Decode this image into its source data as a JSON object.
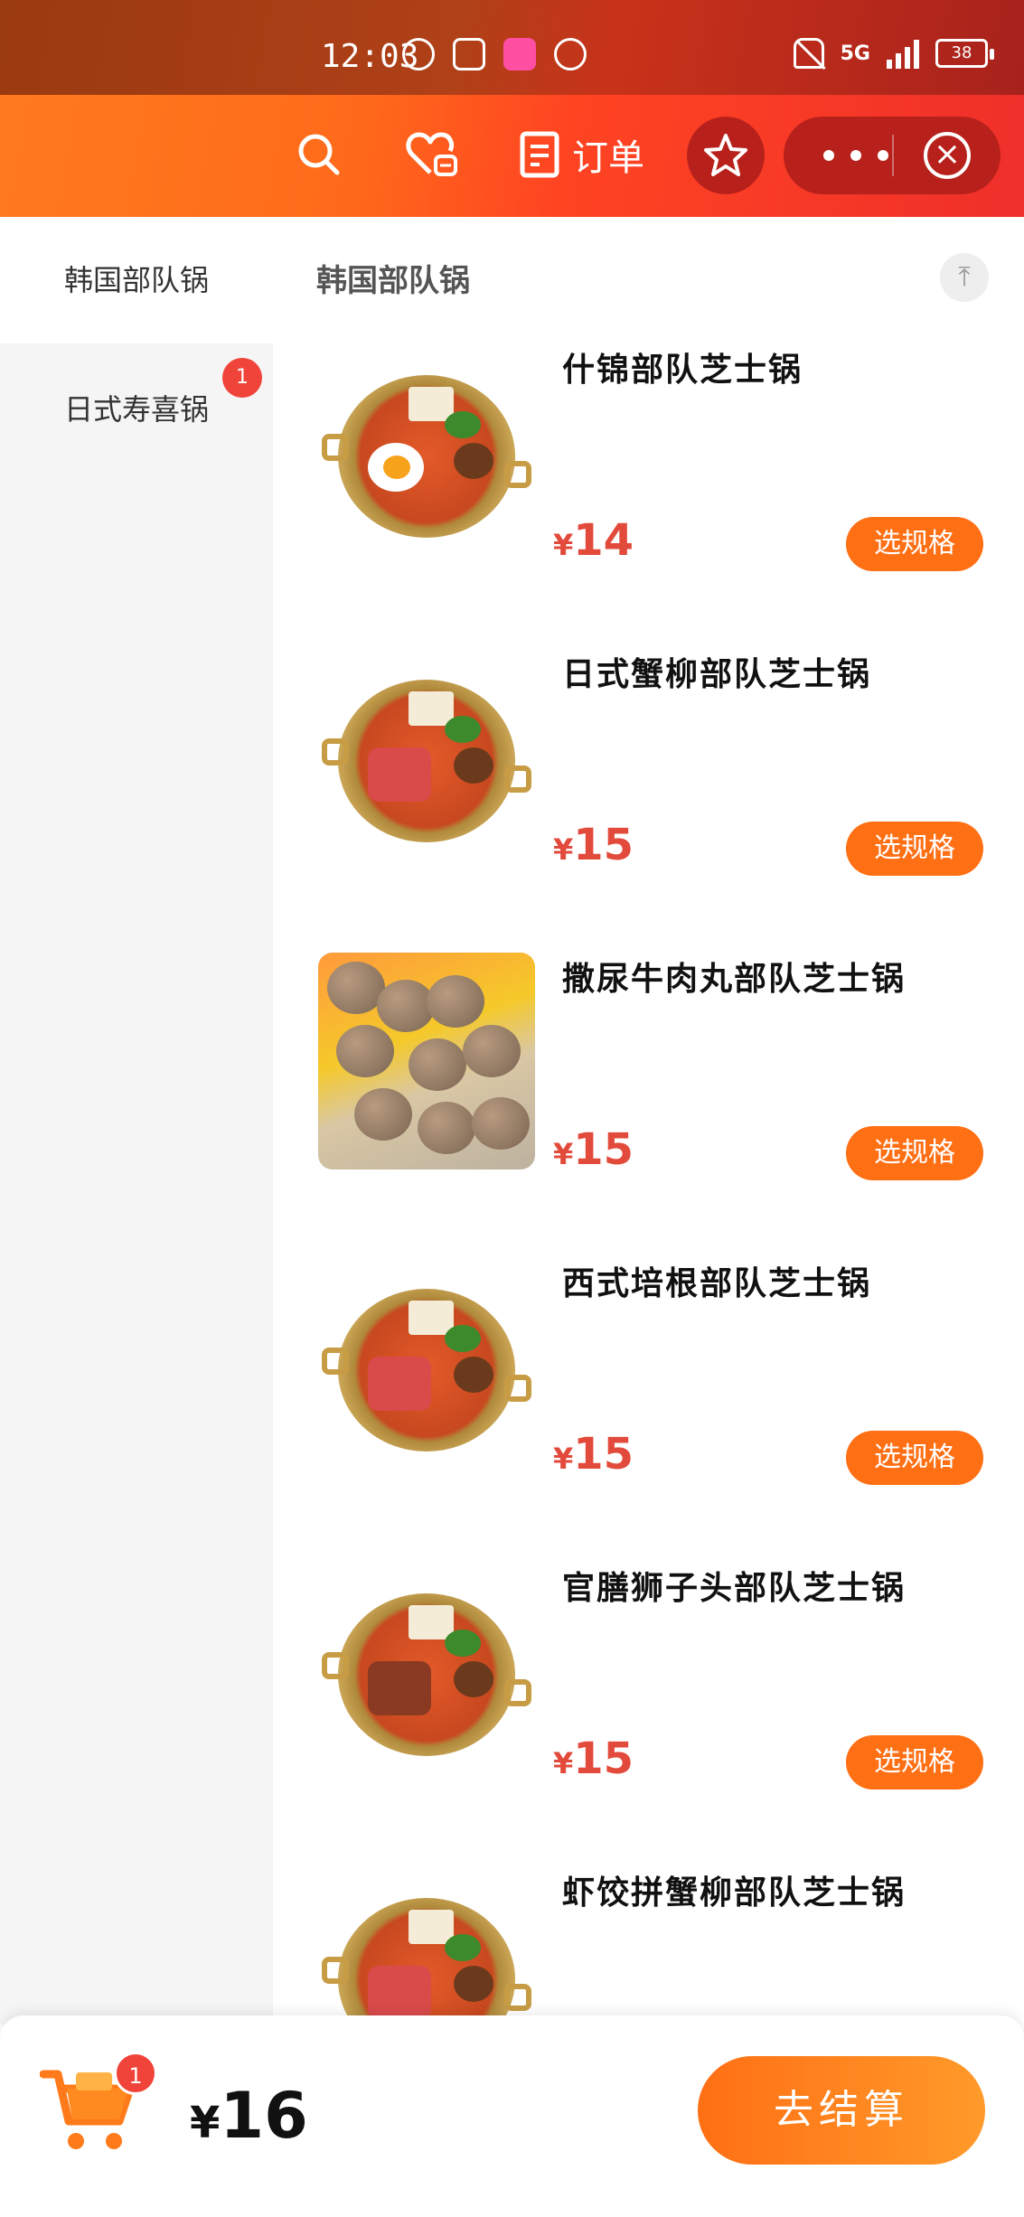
{
  "status_bar": {
    "time": "12:03",
    "network": "5G",
    "battery": "38"
  },
  "top_bar": {
    "order_label": "订单"
  },
  "sidebar": {
    "items": [
      {
        "label": "韩国部队锅"
      },
      {
        "label": "日式寿喜锅",
        "badge": "1"
      }
    ]
  },
  "section": {
    "title": "韩国部队锅"
  },
  "products": [
    {
      "name": "什锦部队芝士锅",
      "currency": "¥",
      "price": "14",
      "button": "选规格"
    },
    {
      "name": "日式蟹柳部队芝士锅",
      "currency": "¥",
      "price": "15",
      "button": "选规格"
    },
    {
      "name": "撒尿牛肉丸部队芝士锅",
      "currency": "¥",
      "price": "15",
      "button": "选规格"
    },
    {
      "name": "西式培根部队芝士锅",
      "currency": "¥",
      "price": "15",
      "button": "选规格"
    },
    {
      "name": "官膳狮子头部队芝士锅",
      "currency": "¥",
      "price": "15",
      "button": "选规格"
    },
    {
      "name": "虾饺拼蟹柳部队芝士锅"
    }
  ],
  "cart": {
    "badge": "1",
    "currency": "¥",
    "total": "16",
    "checkout_label": "去结算"
  },
  "colors": {
    "accent": "#ff6f14",
    "price": "#e24a3b",
    "badge": "#f0443a"
  }
}
